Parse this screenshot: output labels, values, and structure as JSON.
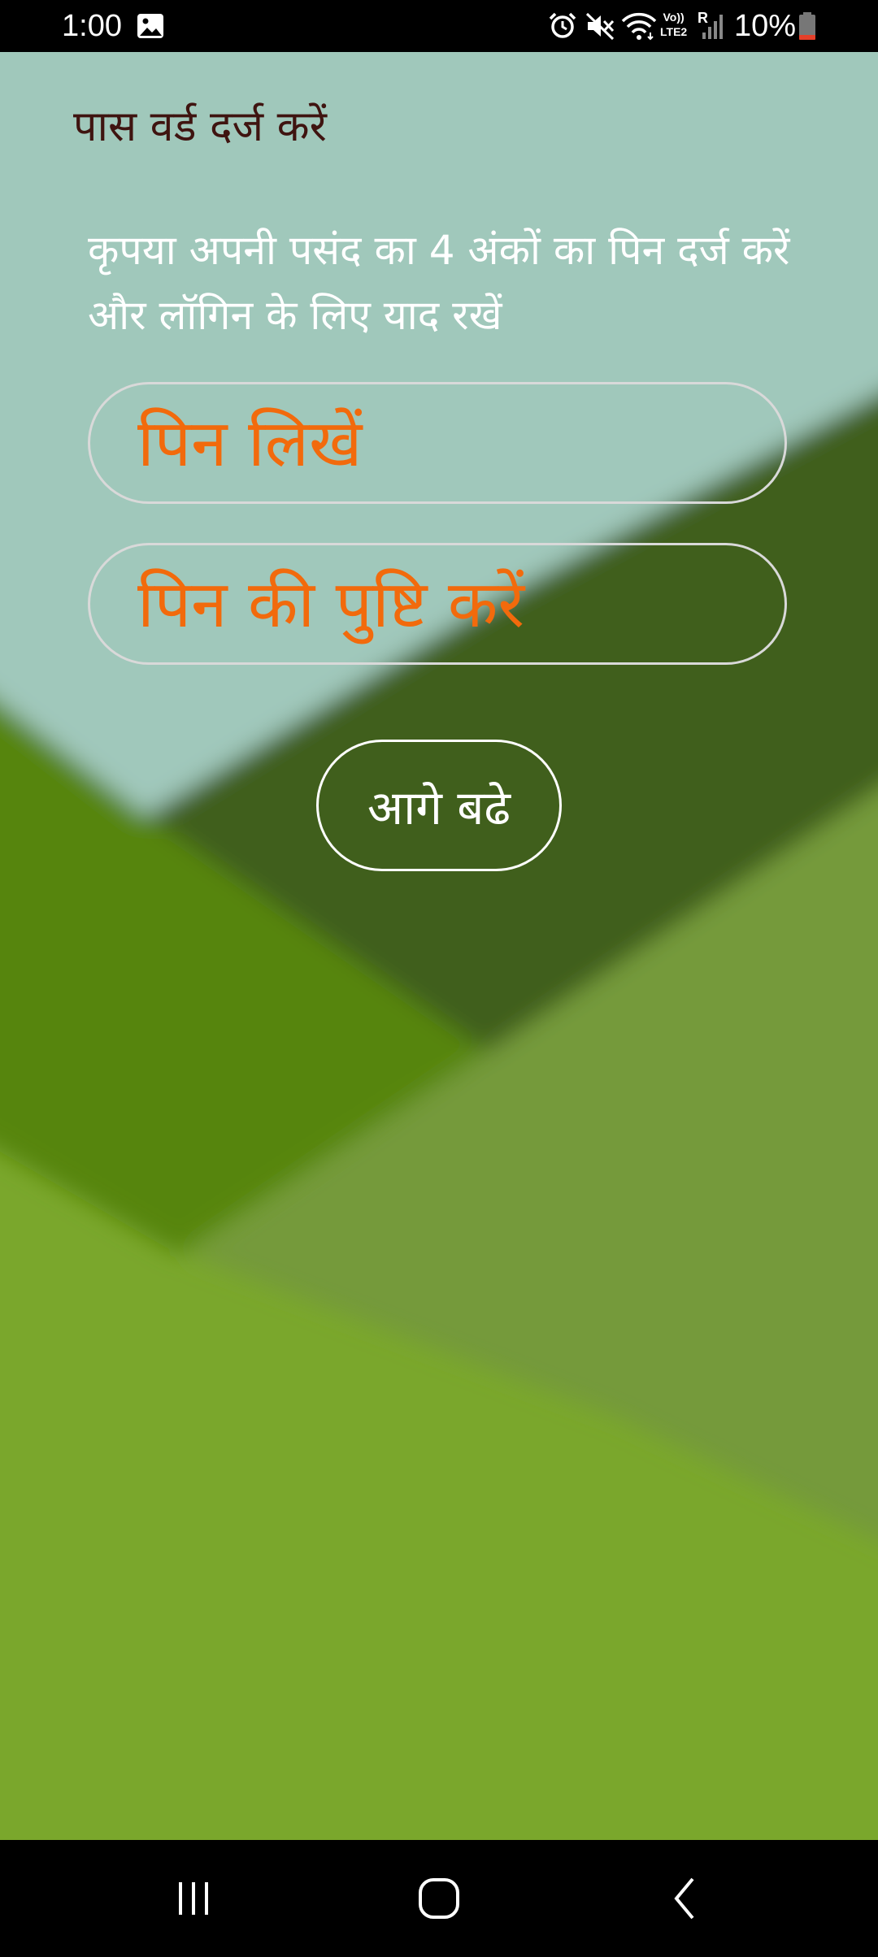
{
  "status_bar": {
    "time": "1:00",
    "battery": "10%",
    "network_label_top": "Vo))",
    "network_label_bottom": "LTE2",
    "roaming": "R",
    "icons": [
      "image-icon",
      "alarm-icon",
      "mute-icon",
      "wifi-icon",
      "signal-icon",
      "battery-icon"
    ]
  },
  "page": {
    "title": "पास वर्ड दर्ज करें",
    "instructions": "कृपया अपनी पसंद का 4 अंकों का पिन दर्ज करें और लॉगिन के लिए याद रखें"
  },
  "form": {
    "pin_placeholder": "पिन लिखें",
    "pin_value": "",
    "confirm_placeholder": "पिन की पुष्टि करें",
    "confirm_value": "",
    "proceed_label": "आगे बढे"
  },
  "nav_bar": {
    "icons": [
      "recent-apps-icon",
      "home-icon",
      "back-icon"
    ]
  },
  "colors": {
    "title": "#3f1410",
    "placeholder": "#f26a0c",
    "field_border": "#d9d9d9",
    "background_light": "#a0c8bb",
    "background_green": "#7aa72c"
  }
}
